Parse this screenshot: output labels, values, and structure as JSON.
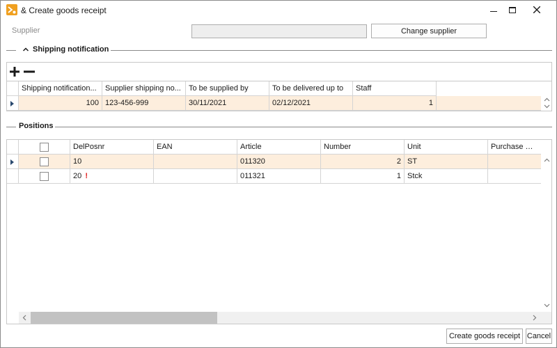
{
  "window": {
    "title": "& Create goods receipt",
    "app_icon": "goods-receipt-icon"
  },
  "supplier": {
    "label": "Supplier",
    "value": "",
    "change_button": "Change supplier"
  },
  "shipping": {
    "section_title": "Shipping notification",
    "toolbar": {
      "add_icon": "plus-icon",
      "remove_icon": "minus-icon"
    },
    "columns": [
      "Shipping notification...",
      "Supplier shipping no...",
      "To be supplied by",
      "To be delivered up to",
      "Staff"
    ],
    "rows": [
      {
        "id": "100",
        "supplier_no": "123-456-999",
        "supplied_by": "30/11/2021",
        "delivered_up_to": "02/12/2021",
        "staff": "1"
      }
    ]
  },
  "positions": {
    "section_title": "Positions",
    "columns": [
      "DelPosnr",
      "EAN",
      "Article",
      "Number",
      "Unit",
      "Purchase Orde"
    ],
    "rows": [
      {
        "delposnr": "10",
        "warning": "",
        "ean": "",
        "article": "011320",
        "number": "2",
        "unit": "ST"
      },
      {
        "delposnr": "20",
        "warning": "!",
        "ean": "",
        "article": "011321",
        "number": "1",
        "unit": "Stck"
      }
    ],
    "hscroll_position": 0
  },
  "footer": {
    "create_button": "Create goods receipt",
    "cancel_button": "Cancel"
  },
  "colors": {
    "selected_row": "#fdeedd",
    "warning": "#e02020",
    "app_icon": "#f0a020"
  }
}
